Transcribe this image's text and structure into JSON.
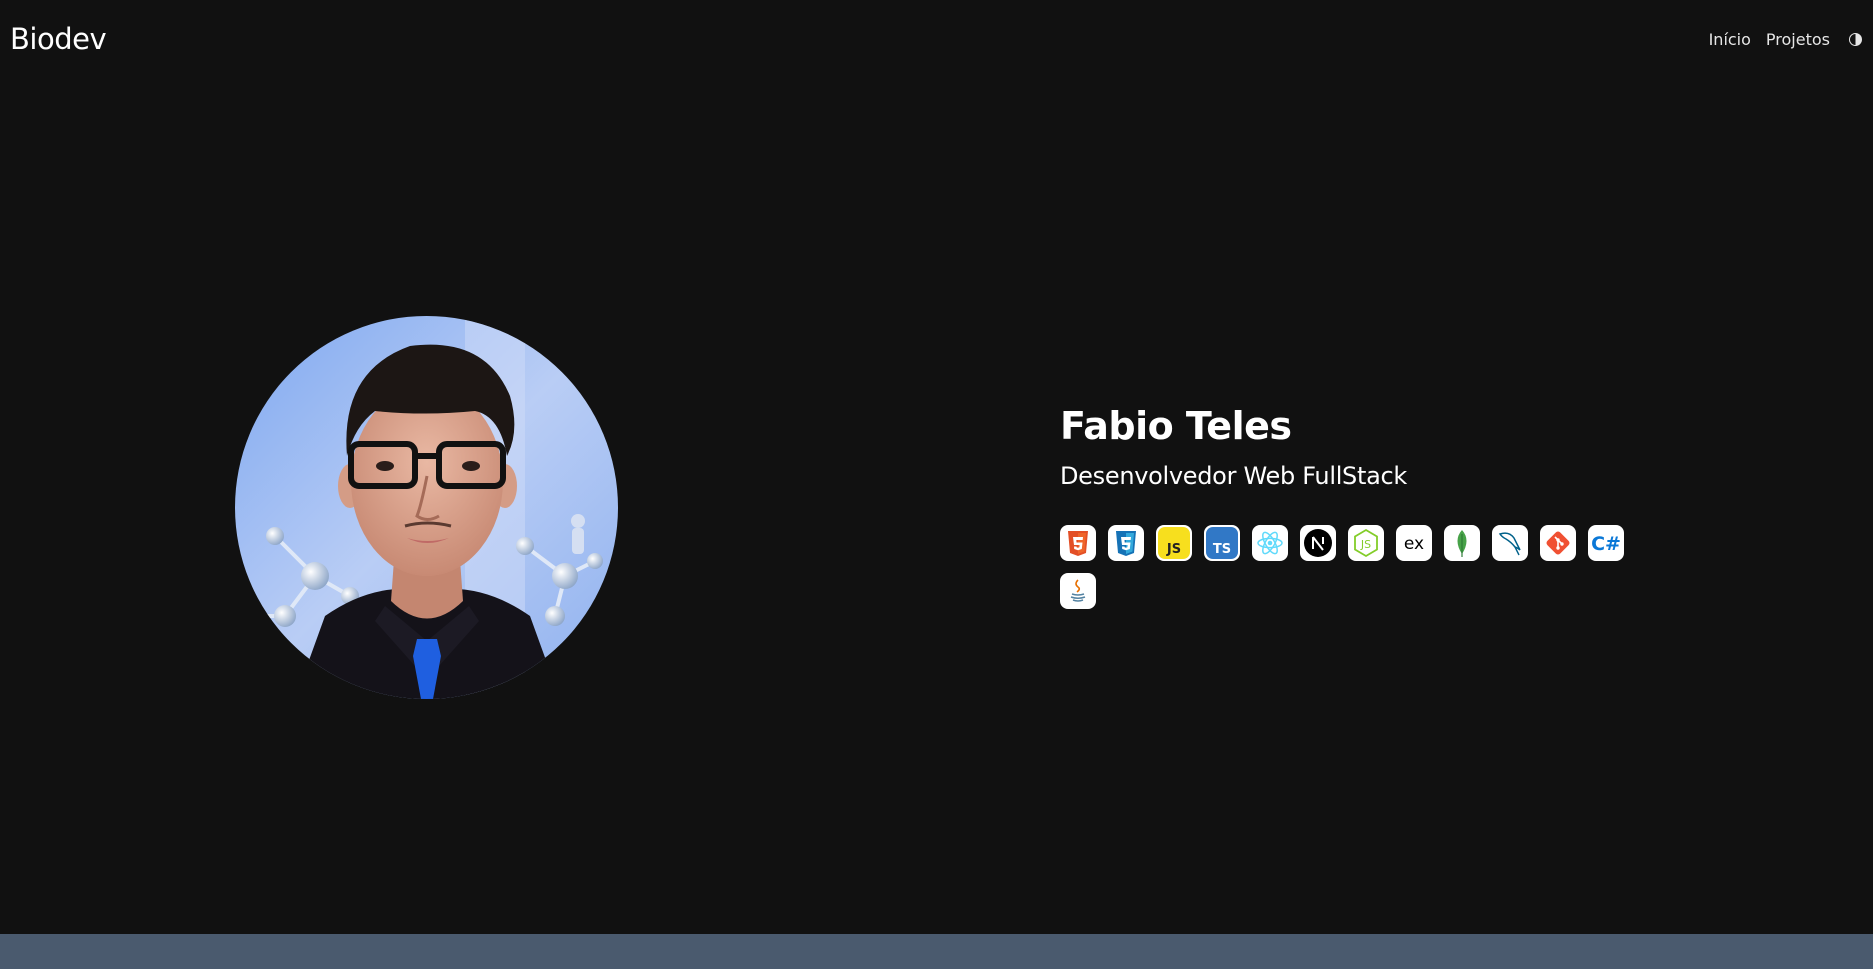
{
  "navbar": {
    "brand": "Biodev",
    "links": [
      {
        "label": "Início"
      },
      {
        "label": "Projetos"
      }
    ],
    "theme_toggle_icon": "half-circle-icon"
  },
  "hero": {
    "name": "Fabio Teles",
    "role": "Desenvolvedor Web FullStack",
    "avatar_icon": "profile-photo"
  },
  "skills": [
    {
      "name": "html5-icon",
      "color": "#e34f26"
    },
    {
      "name": "css3-icon",
      "color": "#1572b6"
    },
    {
      "name": "javascript-icon",
      "color": "#f7df1e"
    },
    {
      "name": "typescript-icon",
      "color": "#3178c6"
    },
    {
      "name": "react-icon",
      "color": "#61dafb"
    },
    {
      "name": "nextjs-icon",
      "color": "#000000"
    },
    {
      "name": "nodejs-icon",
      "color": "#83cd29"
    },
    {
      "name": "express-icon",
      "color": "#000000"
    },
    {
      "name": "mongodb-icon",
      "color": "#47a248"
    },
    {
      "name": "mysql-icon",
      "color": "#00618a"
    },
    {
      "name": "git-icon",
      "color": "#f05032"
    },
    {
      "name": "csharp-icon",
      "color": "#0b78d7"
    },
    {
      "name": "java-icon",
      "color": "#e76f00"
    }
  ],
  "colors": {
    "background": "#111111",
    "footer": "#4a5a6e",
    "text": "#ffffff"
  }
}
